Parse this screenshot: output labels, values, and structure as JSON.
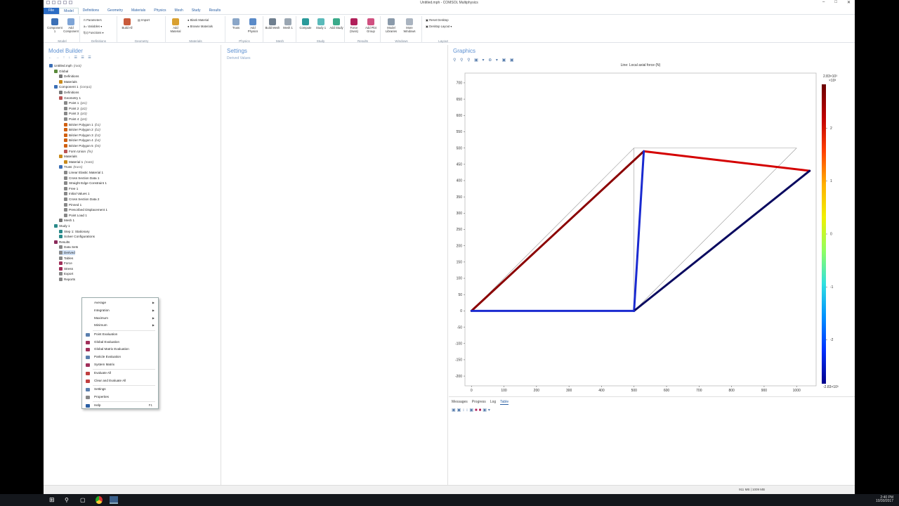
{
  "window": {
    "title": "Untitled.mph - COMSOL Multiphysics"
  },
  "menu_tabs": [
    {
      "label": "File",
      "type": "file"
    },
    {
      "label": "Model",
      "selected": true
    },
    {
      "label": "Definitions"
    },
    {
      "label": "Geometry"
    },
    {
      "label": "Materials"
    },
    {
      "label": "Physics"
    },
    {
      "label": "Mesh"
    },
    {
      "label": "Study"
    },
    {
      "label": "Results"
    }
  ],
  "ribbon": {
    "groups": {
      "model": "Model",
      "definitions": "Definitions",
      "geometry": "Geometry",
      "materials": "Materials",
      "physics": "Physics",
      "mesh": "Mesh",
      "study": "Study",
      "results": "Results",
      "windows": "Windows",
      "layout": "Layout"
    },
    "buttons": {
      "component": "Component 1",
      "add_component": "Add Component",
      "parameters": "Parameters",
      "variables": "Variables",
      "functions": "Functions",
      "build_all": "Build All",
      "import": "Import",
      "add_material": "Add Material",
      "blank_material": "Blank Material",
      "browse_materials": "Browse Materials",
      "truss": "Truss",
      "add_physics": "Add Physics",
      "build_mesh": "Build Mesh",
      "mesh1": "Mesh 1",
      "compute": "Compute",
      "study1": "Study 1",
      "add_study": "Add Study",
      "force": "Force (truss)",
      "add_plot_group": "Add Plot Group",
      "model_libraries": "Model Libraries",
      "more_windows": "More Windows",
      "reset_desktop": "Reset Desktop",
      "desktop_layout": "Desktop Layout"
    }
  },
  "model_builder": {
    "title": "Model Builder",
    "tree": [
      {
        "label": "Untitled.mph",
        "tag": "(root)",
        "level": 0,
        "icon": "#3b6fb6"
      },
      {
        "label": "Global",
        "level": 1,
        "icon": "#5a8a3a"
      },
      {
        "label": "Definitions",
        "level": 2,
        "icon": "#777"
      },
      {
        "label": "Materials",
        "level": 2,
        "icon": "#c98a1b"
      },
      {
        "label": "Component 1",
        "tag": "(comp1)",
        "level": 1,
        "icon": "#3b6fb6"
      },
      {
        "label": "Definitions",
        "level": 2,
        "icon": "#777"
      },
      {
        "label": "Geometry 1",
        "level": 2,
        "icon": "#b55"
      },
      {
        "label": "Point 1",
        "tag": "(pt1)",
        "level": 3,
        "icon": "#888"
      },
      {
        "label": "Point 2",
        "tag": "(pt2)",
        "level": 3,
        "icon": "#888"
      },
      {
        "label": "Point 3",
        "tag": "(pt3)",
        "level": 3,
        "icon": "#888"
      },
      {
        "label": "Point 4",
        "tag": "(pt4)",
        "level": 3,
        "icon": "#888"
      },
      {
        "label": "Bézier Polygon 1",
        "tag": "(b1)",
        "level": 3,
        "icon": "#d06010"
      },
      {
        "label": "Bézier Polygon 2",
        "tag": "(b2)",
        "level": 3,
        "icon": "#d06010"
      },
      {
        "label": "Bézier Polygon 3",
        "tag": "(b3)",
        "level": 3,
        "icon": "#d06010"
      },
      {
        "label": "Bézier Polygon 4",
        "tag": "(b4)",
        "level": 3,
        "icon": "#d06010"
      },
      {
        "label": "Bézier Polygon 5",
        "tag": "(b5)",
        "level": 3,
        "icon": "#d06010"
      },
      {
        "label": "Form Union",
        "tag": "(fin)",
        "level": 3,
        "icon": "#b55"
      },
      {
        "label": "Materials",
        "level": 2,
        "icon": "#c98a1b"
      },
      {
        "label": "Material 1",
        "tag": "(mat1)",
        "level": 3,
        "icon": "#c98a1b"
      },
      {
        "label": "Truss",
        "tag": "(truss)",
        "level": 2,
        "icon": "#3b6fb6"
      },
      {
        "label": "Linear Elastic Material 1",
        "level": 3,
        "icon": "#888"
      },
      {
        "label": "Cross Section Data 1",
        "level": 3,
        "icon": "#888"
      },
      {
        "label": "Straight Edge Constraint 1",
        "level": 3,
        "icon": "#888"
      },
      {
        "label": "Free 1",
        "level": 3,
        "icon": "#888"
      },
      {
        "label": "Initial Values 1",
        "level": 3,
        "icon": "#888"
      },
      {
        "label": "Cross Section Data 2",
        "level": 3,
        "icon": "#888"
      },
      {
        "label": "Pinned 1",
        "level": 3,
        "icon": "#888"
      },
      {
        "label": "Prescribed Displacement 1",
        "level": 3,
        "icon": "#888"
      },
      {
        "label": "Point Load 1",
        "level": 3,
        "icon": "#888"
      },
      {
        "label": "Mesh 1",
        "level": 2,
        "icon": "#777"
      },
      {
        "label": "Study 1",
        "level": 1,
        "icon": "#2a8a8a"
      },
      {
        "label": "Step 1: Stationary",
        "level": 2,
        "icon": "#2a8a8a"
      },
      {
        "label": "Solver Configurations",
        "level": 2,
        "icon": "#2a8a8a"
      },
      {
        "label": "Results",
        "level": 1,
        "icon": "#8a2a5a"
      },
      {
        "label": "Data Sets",
        "level": 2,
        "icon": "#888"
      },
      {
        "label": "Derived",
        "level": 2,
        "icon": "#888",
        "selected": true
      },
      {
        "label": "Tables",
        "level": 2,
        "icon": "#888"
      },
      {
        "label": "Force",
        "level": 2,
        "icon": "#a0305a"
      },
      {
        "label": "Stress",
        "level": 2,
        "icon": "#a0305a"
      },
      {
        "label": "Export",
        "level": 2,
        "icon": "#888"
      },
      {
        "label": "Reports",
        "level": 2,
        "icon": "#888"
      }
    ]
  },
  "context_menu": {
    "items": [
      {
        "label": "Average",
        "submenu": true,
        "icon": ""
      },
      {
        "label": "Integration",
        "submenu": true,
        "icon": ""
      },
      {
        "label": "Maximum",
        "submenu": true,
        "icon": ""
      },
      {
        "label": "Minimum",
        "submenu": true,
        "icon": ""
      },
      {
        "label": "Point Evaluation",
        "icon": "#5a7fae",
        "sep_before": true
      },
      {
        "label": "Global Evaluation",
        "icon": "#a0305a"
      },
      {
        "label": "Global Matrix Evaluation",
        "icon": "#a0305a"
      },
      {
        "label": "Particle Evaluation",
        "icon": "#5a7fae"
      },
      {
        "label": "System Matrix",
        "icon": "#a0305a"
      },
      {
        "label": "Evaluate All",
        "icon": "#c04040",
        "sep_before": true
      },
      {
        "label": "Clear and Evaluate All",
        "icon": "#c04040"
      },
      {
        "label": "Settings",
        "icon": "#5a7fae",
        "sep_before": true
      },
      {
        "label": "Properties",
        "icon": "#888"
      },
      {
        "label": "Help",
        "icon": "#2a5fa3",
        "key": "F1",
        "sep_before": true
      }
    ]
  },
  "settings": {
    "title": "Settings",
    "subtitle": "Derived Values"
  },
  "graphics": {
    "title": "Graphics"
  },
  "chart_data": {
    "type": "line",
    "title": "Line: Local axial force (N)",
    "xlim": [
      -20,
      1060
    ],
    "ylim": [
      -230,
      730
    ],
    "xticks": [
      0,
      100,
      200,
      300,
      400,
      500,
      600,
      700,
      800,
      900,
      1000
    ],
    "yticks": [
      -200,
      -150,
      -100,
      -50,
      0,
      50,
      100,
      150,
      200,
      250,
      300,
      350,
      400,
      450,
      500,
      550,
      600,
      650,
      700
    ],
    "undeformed": [
      {
        "x": [
          0,
          500
        ],
        "y": [
          0,
          500
        ]
      },
      {
        "x": [
          500,
          500
        ],
        "y": [
          0,
          500
        ]
      },
      {
        "x": [
          500,
          1000
        ],
        "y": [
          500,
          500
        ]
      },
      {
        "x": [
          500,
          1000
        ],
        "y": [
          0,
          500
        ]
      },
      {
        "x": [
          0,
          500
        ],
        "y": [
          0,
          0
        ]
      }
    ],
    "members": [
      {
        "x": [
          0,
          530
        ],
        "y": [
          0,
          490
        ],
        "color": "#8b0000"
      },
      {
        "x": [
          530,
          1040
        ],
        "y": [
          490,
          430
        ],
        "color": "#d40000"
      },
      {
        "x": [
          500,
          530
        ],
        "y": [
          0,
          490
        ],
        "color": "#1a2ad0"
      },
      {
        "x": [
          500,
          1040
        ],
        "y": [
          0,
          430
        ],
        "color": "#0a0a60"
      },
      {
        "x": [
          0,
          500
        ],
        "y": [
          0,
          0
        ],
        "color": "#1a2ad0"
      }
    ],
    "colorbar": {
      "max_label": "2.83×10³",
      "min_label": "-2.83×10³",
      "exponent": "×10³",
      "ticks": [
        2,
        1,
        0,
        -1,
        -2
      ],
      "colors": [
        "#6b0000",
        "#c00000",
        "#ff4000",
        "#ffb000",
        "#f0f000",
        "#90ff60",
        "#30e0e0",
        "#0090ff",
        "#0030ff",
        "#00008b"
      ]
    }
  },
  "messages": {
    "tabs": [
      {
        "label": "Messages"
      },
      {
        "label": "Progress"
      },
      {
        "label": "Log"
      },
      {
        "label": "Table",
        "selected": true
      }
    ]
  },
  "status": {
    "memory": "911 MB | 1009 MB"
  },
  "taskbar": {
    "time": "2:40 PM",
    "date": "10/30/2017"
  }
}
